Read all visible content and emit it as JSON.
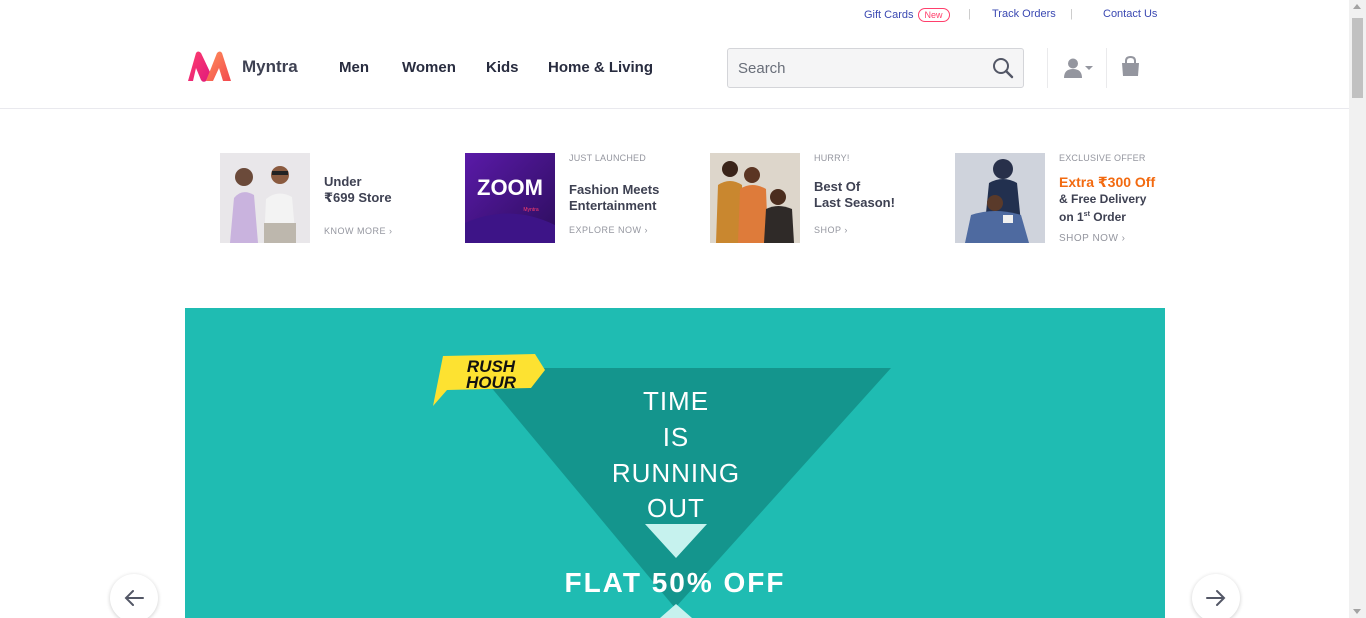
{
  "topbar": {
    "gift_cards": "Gift Cards",
    "new_badge": "New",
    "track_orders": "Track Orders",
    "contact_us": "Contact Us",
    "separator": "|"
  },
  "brand": {
    "name": "Myntra",
    "primary_color": "#ff3f6c"
  },
  "nav": {
    "men": "Men",
    "women": "Women",
    "kids": "Kids",
    "home_living": "Home & Living"
  },
  "search": {
    "placeholder": "Search"
  },
  "promos": [
    {
      "title_line1": "Under",
      "title_line2": "₹699 Store",
      "cta": "KNOW MORE"
    },
    {
      "pre": "JUST LAUNCHED",
      "title_line1": "Fashion Meets",
      "title_line2": "Entertainment",
      "cta": "EXPLORE NOW",
      "image_text": "ZOOM",
      "image_subtext": "Myntra"
    },
    {
      "pre": "HURRY!",
      "title_line1": "Best Of",
      "title_line2": "Last Season!",
      "cta": "SHOP"
    },
    {
      "pre": "EXCLUSIVE OFFER",
      "offer": "Extra ₹300 Off",
      "title_line1": "& Free Delivery",
      "title_line2_prefix": "on 1",
      "title_line2_sup": "st",
      "title_line2_suffix": " Order",
      "cta": "SHOP NOW"
    }
  ],
  "banner": {
    "badge_line1": "RUSH",
    "badge_line2": "HOUR",
    "headline": [
      "TIME",
      "IS",
      "RUNNING",
      "OUT"
    ],
    "offer": "FLAT 50% OFF",
    "bg_color": "#1fbcb2"
  }
}
